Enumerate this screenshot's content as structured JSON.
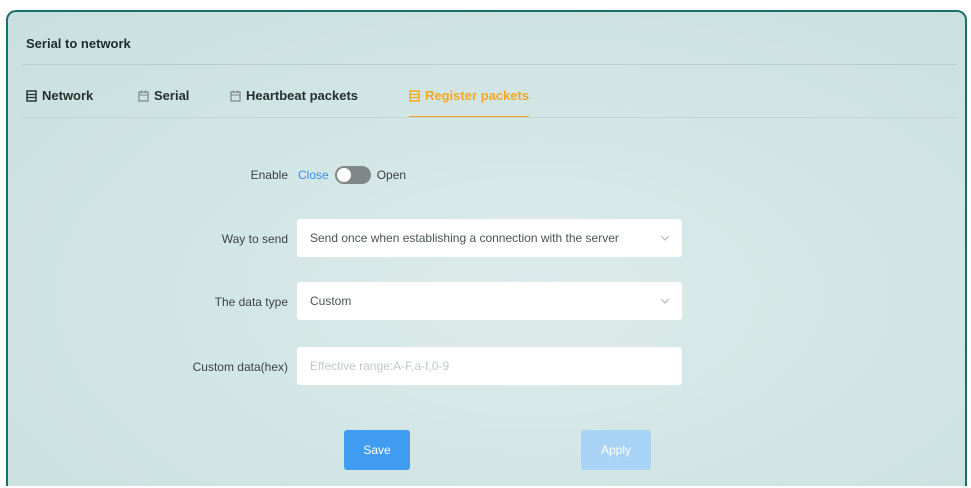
{
  "panel": {
    "title": "Serial to network"
  },
  "tabs": [
    {
      "label": "Network",
      "icon": "server-icon",
      "active": false
    },
    {
      "label": "Serial",
      "icon": "calendar-icon",
      "active": false
    },
    {
      "label": "Heartbeat packets",
      "icon": "calendar-icon",
      "active": false
    },
    {
      "label": "Register packets",
      "icon": "server-icon",
      "active": true
    }
  ],
  "form": {
    "enable": {
      "label": "Enable",
      "off_label": "Close",
      "on_label": "Open",
      "state": "Close"
    },
    "way_to_send": {
      "label": "Way to send",
      "value": "Send once when establishing a connection with the server"
    },
    "data_type": {
      "label": "The data type",
      "value": "Custom"
    },
    "custom_data": {
      "label": "Custom data(hex)",
      "placeholder": "Effective range:A-F,a-f,0-9"
    }
  },
  "buttons": {
    "save": "Save",
    "apply": "Apply"
  },
  "colors": {
    "accent": "#f5a623",
    "primary_button": "#3f9cf0",
    "disabled_button": "#a9d3f5",
    "link": "#3a8ee6"
  }
}
